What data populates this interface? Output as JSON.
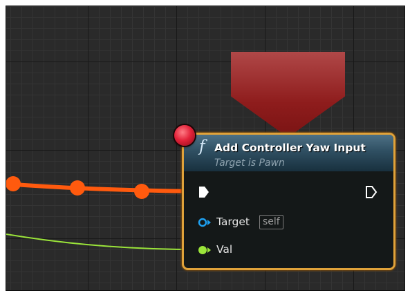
{
  "node": {
    "function_icon": "f",
    "title": "Add Controller Yaw Input",
    "subtitle": "Target is Pawn",
    "pins": {
      "exec_in": {
        "icon": "exec-pin-in-icon",
        "connected": true
      },
      "exec_out": {
        "icon": "exec-pin-out-icon",
        "connected": false
      },
      "target": {
        "label": "Target",
        "default": "self",
        "color": "#1ea1f2"
      },
      "val": {
        "label": "Val",
        "color": "#9be53a"
      }
    },
    "header_color": "#3d5f73",
    "selection_outline_color": "#e0a23a"
  },
  "wires": {
    "exec_wire_color": "#ff5a0e",
    "float_wire_color": "#9be53a"
  },
  "breakpoint": {
    "color": "#e3233a",
    "enabled": true
  },
  "graph": {
    "background_color": "#2a2a2a"
  }
}
